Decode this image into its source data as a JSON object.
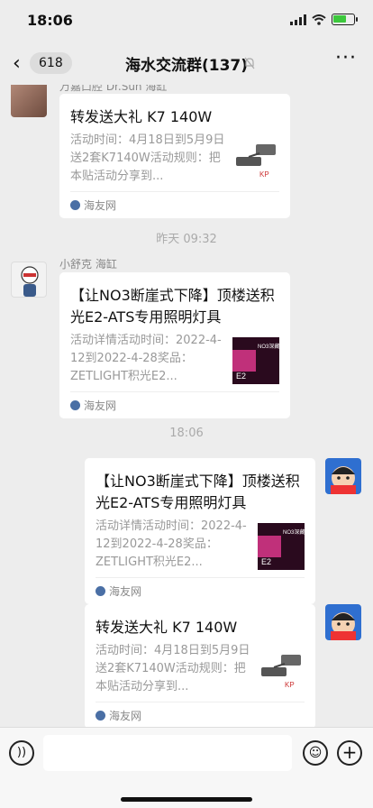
{
  "status": {
    "time": "18:06"
  },
  "nav": {
    "unread_count": "618",
    "title": "海水交流群(137)"
  },
  "messages": [
    {
      "sender": "万嘉口腔 Dr.Sun 海缸",
      "card": {
        "title": "转发送大礼 K7 140W",
        "desc": "活动时间：4月18日到5月9日送2套K7140W活动规则：把本贴活动分享到...",
        "source": "海友网"
      }
    },
    {
      "sender": "小舒克 海缸",
      "card": {
        "title": "【让NO3断崖式下降】顶楼送积光E2-ATS专用照明灯具",
        "desc": "活动详情活动时间：2022-4-12到2022-4-28奖品：ZETLIGHT积光E2...",
        "source": "海友网"
      }
    },
    {
      "card": {
        "title": "【让NO3断崖式下降】顶楼送积光E2-ATS专用照明灯具",
        "desc": "活动详情活动时间：2022-4-12到2022-4-28奖品：ZETLIGHT积光E2...",
        "source": "海友网"
      }
    },
    {
      "card": {
        "title": "转发送大礼 K7 140W",
        "desc": "活动时间：4月18日到5月9日送2套K7140W活动规则：把本贴活动分享到...",
        "source": "海友网"
      }
    }
  ],
  "separators": [
    "昨天 09:32",
    "18:06"
  ],
  "thumbs": {
    "lamp_logo": "KP",
    "poster_text": "NO3深藏 50大便宜",
    "poster_label": "E2"
  },
  "icons": {
    "back": "chevron-left-icon",
    "mute": "mute-bell-icon",
    "more": "more-dots-icon",
    "voice": "voice-icon",
    "emoji": "emoji-icon",
    "plus": "plus-icon",
    "source": "haiyou-logo-icon"
  },
  "colors": {
    "background": "#ededed",
    "bubble": "#ffffff",
    "battery": "#3cc83c"
  }
}
